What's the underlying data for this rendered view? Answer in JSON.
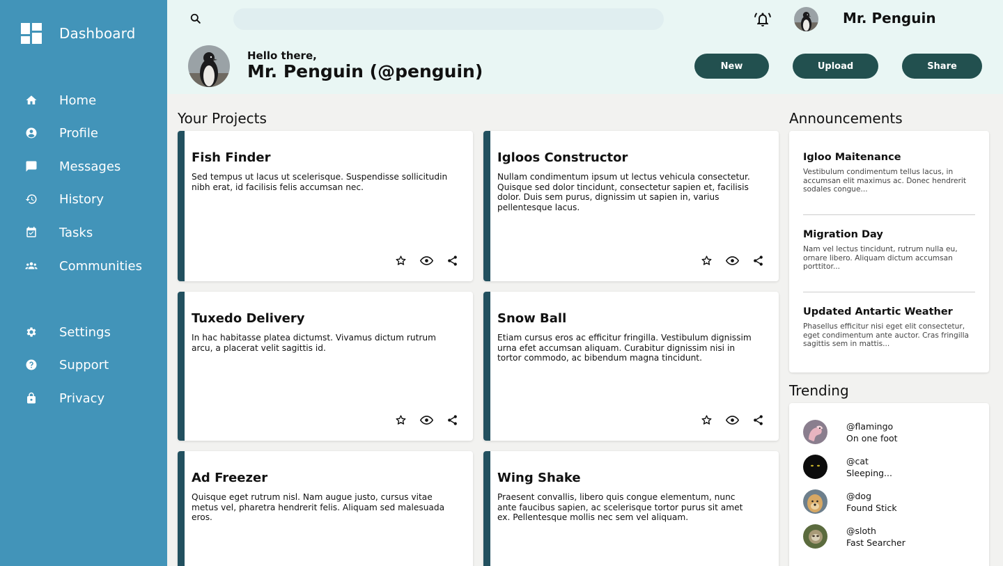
{
  "sidebar": {
    "title": "Dashboard",
    "nav": [
      {
        "label": "Home",
        "icon": "home-icon"
      },
      {
        "label": "Profile",
        "icon": "account-icon"
      },
      {
        "label": "Messages",
        "icon": "message-icon"
      },
      {
        "label": "History",
        "icon": "history-icon"
      },
      {
        "label": "Tasks",
        "icon": "calendar-check-icon"
      },
      {
        "label": "Communities",
        "icon": "group-icon"
      }
    ],
    "secondary": [
      {
        "label": "Settings",
        "icon": "gear-icon"
      },
      {
        "label": "Support",
        "icon": "help-icon"
      },
      {
        "label": "Privacy",
        "icon": "lock-icon"
      }
    ]
  },
  "header": {
    "search_placeholder": "",
    "username": "Mr. Penguin",
    "greeting": "Hello there,",
    "display_name": "Mr. Penguin (@penguin)",
    "buttons": {
      "new": "New",
      "upload": "Upload",
      "share": "Share"
    }
  },
  "projects": {
    "title": "Your Projects",
    "items": [
      {
        "title": "Fish Finder",
        "text": "Sed tempus ut lacus ut scelerisque. Suspendisse sollicitudin nibh erat, id facilisis felis accumsan nec."
      },
      {
        "title": "Igloos Constructor",
        "text": "Nullam condimentum ipsum ut lectus vehicula consectetur. Quisque sed dolor tincidunt, consectetur sapien et, facilisis dolor. Duis sem purus, dignissim ut sapien in, varius pellentesque lacus."
      },
      {
        "title": "Tuxedo Delivery",
        "text": "In hac habitasse platea dictumst. Vivamus dictum rutrum arcu, a placerat velit sagittis id."
      },
      {
        "title": "Snow Ball",
        "text": "Etiam cursus eros ac efficitur fringilla. Vestibulum dignissim urna efet accumsan aliquam. Curabitur dignissim nisi in tortor commodo, ac bibendum magna tincidunt."
      },
      {
        "title": "Ad Freezer",
        "text": "Quisque eget rutrum nisl. Nam augue justo, cursus vitae metus vel, pharetra hendrerit felis. Aliquam sed malesuada eros."
      },
      {
        "title": "Wing Shake",
        "text": "Praesent convallis, libero quis congue elementum, nunc ante faucibus sapien, ac scelerisque tortor purus sit amet ex. Pellentesque mollis nec sem vel aliquam."
      }
    ]
  },
  "announcements": {
    "title": "Announcements",
    "items": [
      {
        "title": "Igloo Maitenance",
        "text": "Vestibulum condimentum tellus lacus, in accumsan elit maximus ac. Donec hendrerit sodales congue..."
      },
      {
        "title": "Migration Day",
        "text": "Nam vel lectus tincidunt, rutrum nulla eu, ornare libero. Aliquam dictum accumsan porttitor..."
      },
      {
        "title": "Updated Antartic Weather",
        "text": "Phasellus efficitur nisi eget elit consectetur, eget condimentum ante auctor. Cras fringilla sagittis sem in mattis..."
      }
    ]
  },
  "trending": {
    "title": "Trending",
    "items": [
      {
        "handle": "@flamingo",
        "status": "On one foot"
      },
      {
        "handle": "@cat",
        "status": "Sleeping..."
      },
      {
        "handle": "@dog",
        "status": "Found Stick"
      },
      {
        "handle": "@sloth",
        "status": "Fast Searcher"
      }
    ]
  },
  "colors": {
    "sidebar": "#4294b9",
    "header": "#e9f6f4",
    "button": "#22504f",
    "card_accent": "#22505f",
    "background": "#f2f2f0"
  }
}
